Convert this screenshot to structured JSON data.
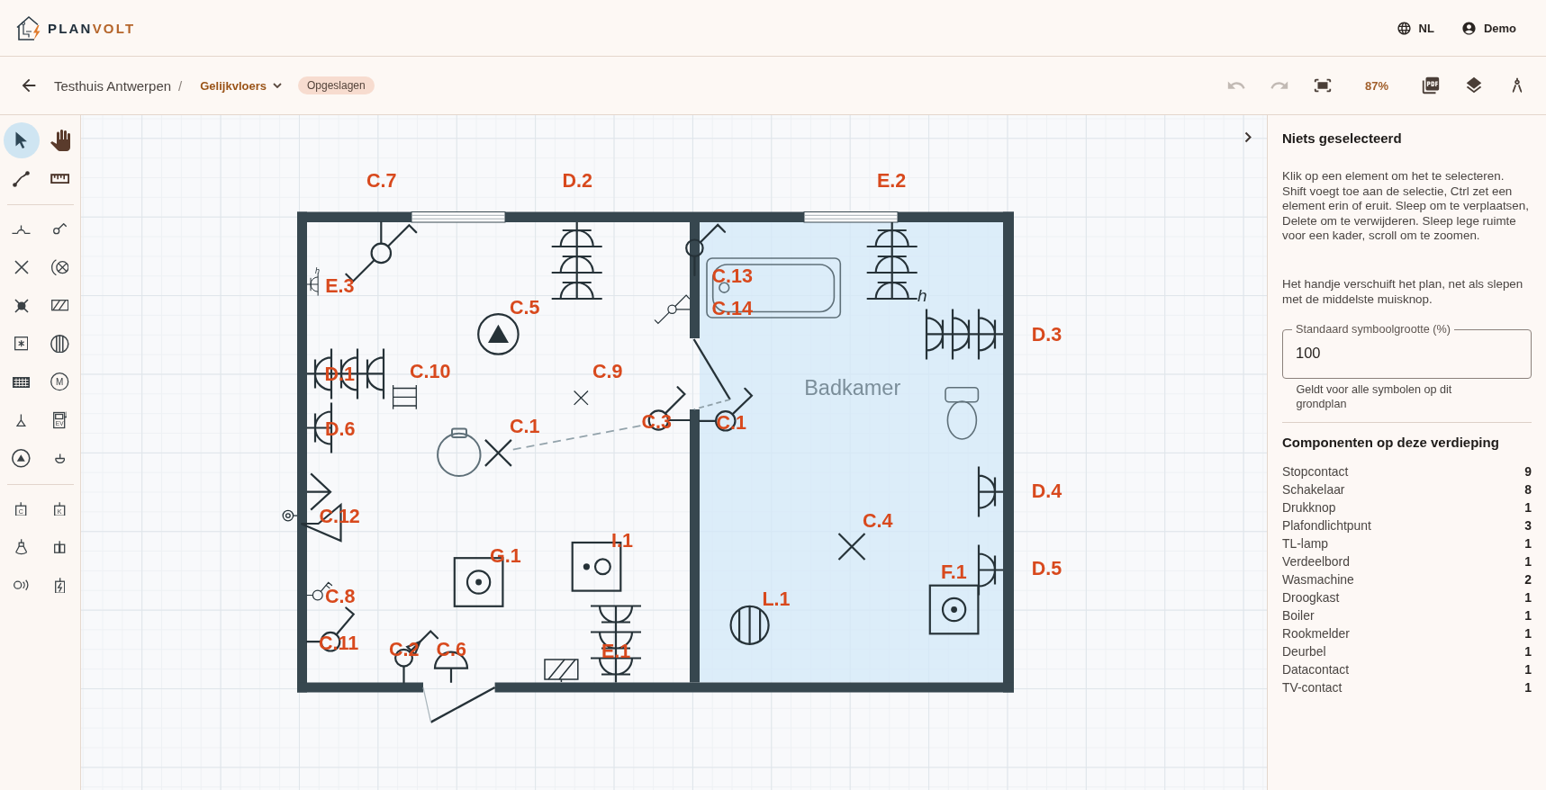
{
  "header": {
    "logo": {
      "primary": "PLAN",
      "accent": "VOLT"
    },
    "language": "NL",
    "user": "Demo"
  },
  "breadcrumb": {
    "project": "Testhuis Antwerpen",
    "separator": "/",
    "floor": "Gelijkvloers",
    "status": "Opgeslagen"
  },
  "toolbar": [
    {
      "kind": "undo",
      "disabled": true
    },
    {
      "kind": "redo",
      "disabled": true
    },
    {
      "kind": "fit",
      "disabled": false
    },
    {
      "kind": "zoom",
      "label": "87%"
    },
    {
      "kind": "pdf",
      "disabled": false
    },
    {
      "kind": "layers",
      "disabled": false
    },
    {
      "kind": "compass",
      "disabled": false
    }
  ],
  "tool_groups": [
    {
      "tools": [
        {
          "kind": "pointer",
          "selected": true
        },
        {
          "kind": "hand",
          "selected": false
        },
        {
          "kind": "wire",
          "selected": false
        },
        {
          "kind": "ruler",
          "selected": false
        }
      ]
    },
    {
      "tools": [
        {
          "kind": "socket",
          "selected": false
        },
        {
          "kind": "switch",
          "selected": false
        },
        {
          "kind": "cross",
          "selected": false
        },
        {
          "kind": "circledcross",
          "selected": false
        },
        {
          "kind": "dotcross",
          "selected": false
        },
        {
          "kind": "hatchbox",
          "selected": false
        },
        {
          "kind": "asteriskbox",
          "selected": false
        },
        {
          "kind": "stripedcircle",
          "selected": false
        },
        {
          "kind": "gridbox",
          "selected": false
        },
        {
          "kind": "lettercircle",
          "text": "M",
          "selected": false
        },
        {
          "kind": "triangle",
          "selected": false
        },
        {
          "kind": "charger",
          "text": "EV",
          "selected": false
        },
        {
          "kind": "trianglecircle",
          "selected": false
        },
        {
          "kind": "dome",
          "selected": false
        }
      ]
    },
    {
      "tools": [
        {
          "kind": "letterbox",
          "text": "C",
          "selected": false
        },
        {
          "kind": "letterbox",
          "text": "K",
          "selected": false
        },
        {
          "kind": "lamp",
          "selected": false
        },
        {
          "kind": "doublebox",
          "selected": false
        },
        {
          "kind": "buzzer",
          "selected": false
        },
        {
          "kind": "boltbox",
          "selected": false
        }
      ]
    }
  ],
  "floor_plan": {
    "rooms": [
      {
        "label": "Badkamer"
      }
    ],
    "symbols": [
      {
        "kind": "twoway",
        "label": "C.7"
      },
      {
        "kind": "triplesocket",
        "label": "D.2"
      },
      {
        "kind": "triplesocket",
        "label": "E.2",
        "mark": "h"
      },
      {
        "kind": "switch",
        "label": "C.13"
      },
      {
        "kind": "socket",
        "label": "E.3",
        "mark": "h"
      },
      {
        "kind": "smokedetector",
        "label": "C.5"
      },
      {
        "kind": "twoway",
        "label": "C.14"
      },
      {
        "kind": "triplesocket",
        "label": "D.3"
      },
      {
        "kind": "triplesocket",
        "label": "D.1"
      },
      {
        "kind": "tube",
        "label": "C.10"
      },
      {
        "kind": "light",
        "label": "C.9"
      },
      {
        "kind": "socket",
        "label": "D.6"
      },
      {
        "kind": "light",
        "label": "C.1"
      },
      {
        "kind": "switch",
        "label": "C.3"
      },
      {
        "kind": "switch",
        "label": "C.1"
      },
      {
        "kind": "socket",
        "label": "D.4"
      },
      {
        "kind": "dataoutlet",
        "label": "C.12"
      },
      {
        "kind": "light",
        "label": "C.4"
      },
      {
        "kind": "dryer",
        "label": "I.1"
      },
      {
        "kind": "washer",
        "label": "G.1"
      },
      {
        "kind": "washer",
        "label": "F.1"
      },
      {
        "kind": "socket",
        "label": "D.5"
      },
      {
        "kind": "doublepole",
        "label": "C.8"
      },
      {
        "kind": "boiler",
        "label": "L.1"
      },
      {
        "kind": "switch",
        "label": "C.11"
      },
      {
        "kind": "dimmer",
        "label": "C.2"
      },
      {
        "kind": "bell",
        "label": "C.6"
      },
      {
        "kind": "triplesocket",
        "label": "E.1"
      }
    ]
  },
  "panel": {
    "title": "Niets geselecteerd",
    "paragraphs": [
      "Klik op een element om het te selecteren. Shift voegt toe aan de selectie, Ctrl zet een element erin of eruit. Sleep om te verplaatsen, Delete om te verwijderen. Sleep lege ruimte voor een kader, scroll om te zoomen.",
      "Het handje verschuift het plan, net als slepen met de middelste muisknop."
    ],
    "symbol_size": {
      "label": "Standaard symboolgrootte (%)",
      "value": "100",
      "helper": "Geldt voor alle symbolen op dit grondplan"
    },
    "components": {
      "title": "Componenten op deze verdieping",
      "items": [
        {
          "name": "Stopcontact",
          "count": "9"
        },
        {
          "name": "Schakelaar",
          "count": "8"
        },
        {
          "name": "Drukknop",
          "count": "1"
        },
        {
          "name": "Plafondlichtpunt",
          "count": "3"
        },
        {
          "name": "TL-lamp",
          "count": "1"
        },
        {
          "name": "Verdeelbord",
          "count": "1"
        },
        {
          "name": "Wasmachine",
          "count": "2"
        },
        {
          "name": "Droogkast",
          "count": "1"
        },
        {
          "name": "Boiler",
          "count": "1"
        },
        {
          "name": "Rookmelder",
          "count": "1"
        },
        {
          "name": "Deurbel",
          "count": "1"
        },
        {
          "name": "Datacontact",
          "count": "1"
        },
        {
          "name": "TV-contact",
          "count": "1"
        }
      ]
    }
  }
}
